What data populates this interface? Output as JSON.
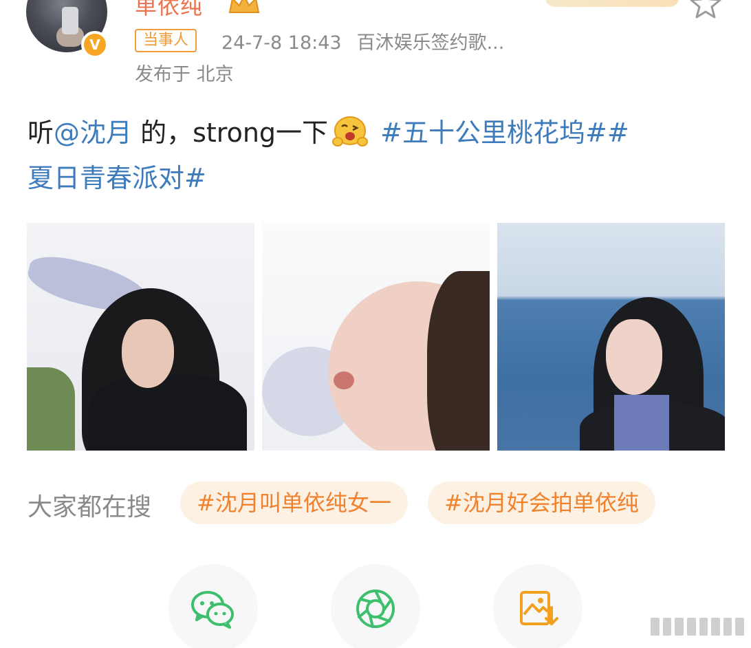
{
  "post": {
    "author": {
      "name": "单依纯",
      "verified": true,
      "role_tag": "当事人"
    },
    "timestamp": "24-7-8 18:43",
    "source": "百沐娱乐签约歌...",
    "location": "发布于 北京",
    "text": {
      "prefix": "听",
      "mention": "@沈月",
      "middle": " 的，strong一下",
      "hashtags_line1": " #五十公里桃花坞##",
      "hashtags_line2": "夏日青春派对#"
    },
    "photo_count": 3
  },
  "trending": {
    "label": "大家都在搜",
    "items": [
      "#沈月叫单依纯女一",
      "#沈月好会拍单依纯"
    ]
  },
  "share": {
    "items": [
      "wechat-icon",
      "moments-icon",
      "save-image-icon"
    ]
  },
  "colors": {
    "username": "#eb7350",
    "link": "#3e7bbd",
    "tag_border": "#f29a3a",
    "trend_text": "#f0812d",
    "trend_bg": "#fdf1e4",
    "wechat_green": "#3dbf6e",
    "save_orange": "#f2a01e"
  }
}
